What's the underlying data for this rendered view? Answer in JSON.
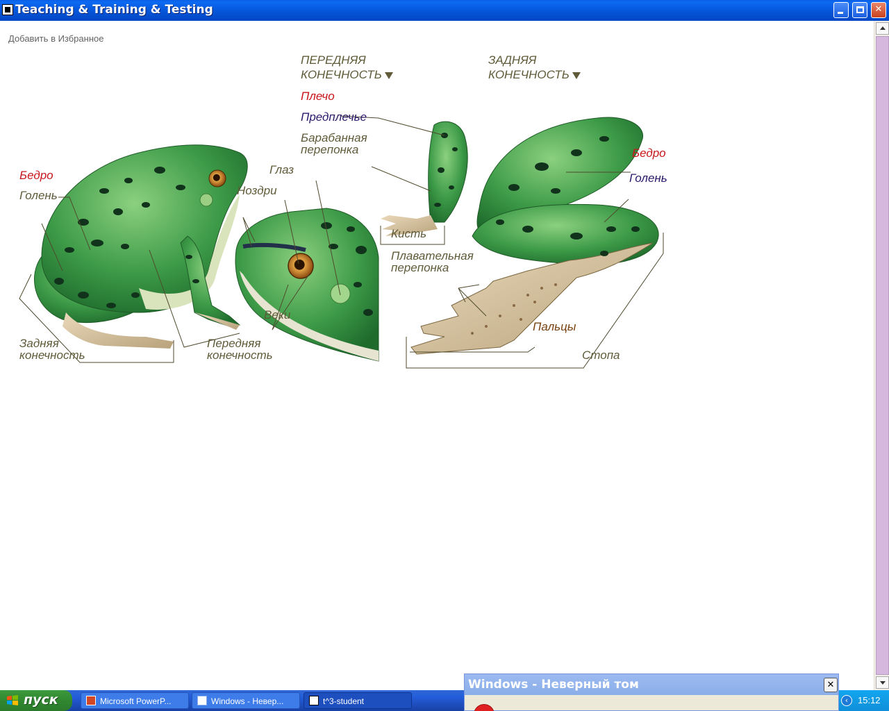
{
  "window": {
    "title": "Teaching & Training & Testing",
    "minimize": "_",
    "maximize": "□",
    "close": "✕"
  },
  "page": {
    "favorite_link": "Добавить в Избранное"
  },
  "figure": {
    "heading_front": [
      "ПЕРЕДНЯЯ",
      "КОНЕЧНОСТЬ"
    ],
    "heading_hind": [
      "ЗАДНЯЯ",
      "КОНЕЧНОСТЬ"
    ],
    "labels": {
      "bedro_left": "Бедро",
      "golen_left": "Голень",
      "zadnyaya": [
        "Задняя",
        "конечность"
      ],
      "perednyaya": [
        "Передняя",
        "конечность"
      ],
      "nozdri": "Ноздри",
      "glaz": "Глаз",
      "veki": "Веки",
      "plecho": "Плечо",
      "predplechye": "Предплечье",
      "barabannaya": [
        "Барабанная",
        "перепонка"
      ],
      "kist": "Кисть",
      "plavatelnaya": [
        "Плавательная",
        "перепонка"
      ],
      "paltsy": "Пальцы",
      "stopa": "Стопа",
      "bedro_right": "Бедро",
      "golen_right": "Голень"
    },
    "colors": {
      "label": "#5f5b39",
      "red": "#c8161d",
      "blue": "#2d1a6b",
      "frog_green": "#3c9a47",
      "frog_light": "#8bd07f",
      "spot": "#11331c",
      "belly": "#d9e4bd",
      "skin_foot": "#c9b89a"
    }
  },
  "taskbar": {
    "start_label": "пуск",
    "tasks": [
      {
        "label": "Microsoft PowerP...",
        "icon": "powerpoint-icon",
        "active": false
      },
      {
        "label": "Windows - Невер...",
        "icon": "window-icon",
        "active": false
      },
      {
        "label": "t^3-student",
        "icon": "app-icon",
        "active": true
      }
    ],
    "clock": "15:12",
    "tray_chevron": "‹"
  },
  "dialog": {
    "title": "Windows - Неверный том",
    "close": "✕"
  }
}
